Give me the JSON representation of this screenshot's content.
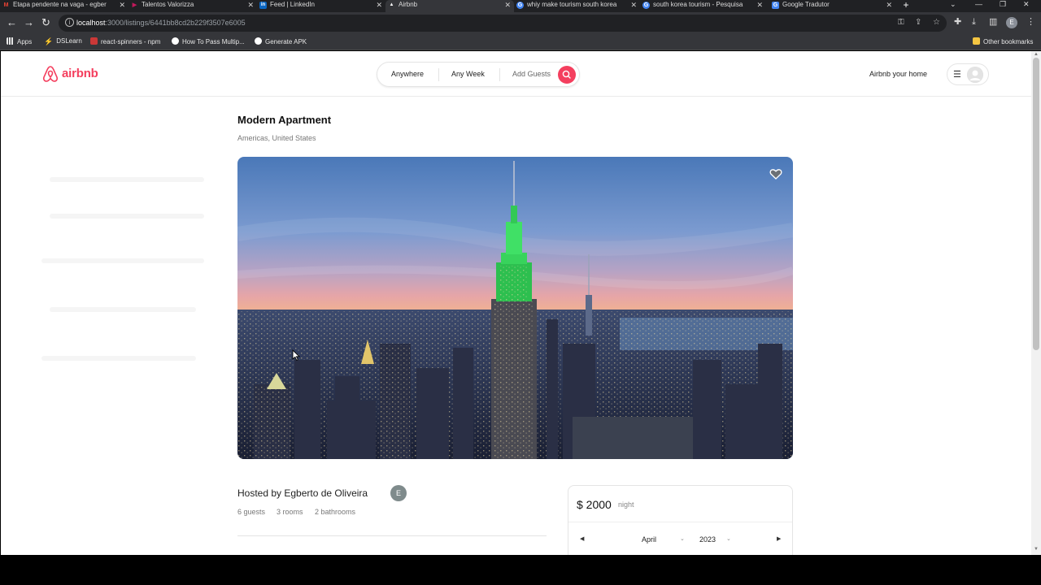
{
  "browser": {
    "tabs": [
      {
        "label": "Etapa pendente na vaga - egber",
        "icon": "M",
        "icon_color": "#ea4335"
      },
      {
        "label": "Talentos Valorizza",
        "icon": "▶",
        "icon_color": "#c2185b"
      },
      {
        "label": "Feed | LinkedIn",
        "icon": "in",
        "icon_color": "#0a66c2"
      },
      {
        "label": "Airbnb",
        "icon": "▲",
        "icon_color": "#ffffff"
      },
      {
        "label": "whiy make tourism south korea",
        "icon": "G",
        "icon_color": "#4285f4"
      },
      {
        "label": "south korea tourism - Pesquisa",
        "icon": "G",
        "icon_color": "#4285f4"
      },
      {
        "label": "Google Tradutor",
        "icon": "G",
        "icon_color": "#4285f4"
      }
    ],
    "url_host": "localhost",
    "url_path": ":3000/listings/6441bb8cd2b229f3507e6005",
    "profile_initial": "E",
    "bookmarks": [
      "Apps",
      "DSLearn",
      "react-spinners - npm",
      "How To Pass Multip...",
      "Generate APK"
    ],
    "other_bookmarks": "Other bookmarks"
  },
  "header": {
    "logo_text": "airbnb",
    "search": {
      "anywhere": "Anywhere",
      "any_week": "Any Week",
      "add_guests": "Add Guests"
    },
    "host_link": "Airbnb your home"
  },
  "listing": {
    "title": "Modern Apartment",
    "location": "Americas, United States",
    "hosted_by": "Hosted by Egberto de Oliveira",
    "host_initial": "E",
    "guests": "6 guests",
    "rooms": "3 rooms",
    "bathrooms": "2 bathrooms"
  },
  "reservation": {
    "price": "$ 2000",
    "per": "night",
    "month": "April",
    "year": "2023"
  },
  "colors": {
    "brand": "#f43f5e"
  }
}
